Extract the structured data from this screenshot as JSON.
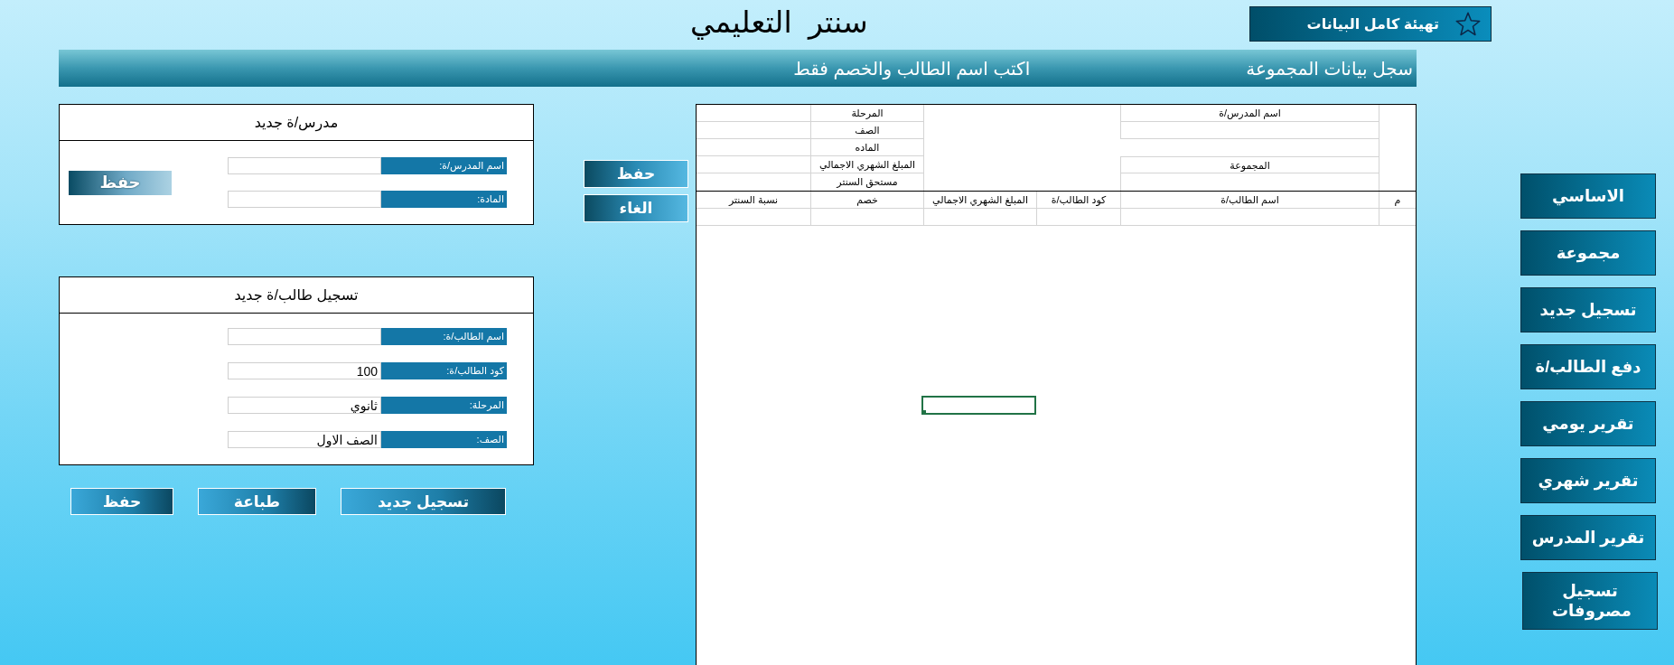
{
  "header": {
    "title": "سنتر  التعليمي",
    "reset_button": "تهيئة كامل البيانات"
  },
  "banner": {
    "title": "سجل بيانات المجموعة",
    "hint": "اكتب اسم الطالب والخصم فقط"
  },
  "teacher_form": {
    "title": "مدرس/ة جديد",
    "fields": [
      {
        "label": "اسم المدرس/ة:"
      },
      {
        "label": "المادة:"
      }
    ],
    "save_button": "حفظ"
  },
  "student_form": {
    "title": "تسجيل طالب/ة جديد",
    "fields": [
      {
        "label": "اسم الطالب/ة:"
      },
      {
        "label": "كود الطالب/ة:",
        "value": "100"
      },
      {
        "label": "المرحلة:",
        "value": "ثانوي"
      },
      {
        "label": "الصف:",
        "value": "الصف الاول"
      }
    ]
  },
  "form_buttons": [
    "تسجيل جديد",
    "طباعة",
    "حفظ"
  ],
  "sheet_buttons": [
    "حفظ",
    "الغاء"
  ],
  "sheet": {
    "teacher_label": "اسم المدرس/ة",
    "group_label": "المجموعة",
    "info_labels": [
      "المرحلة",
      "الصف",
      "الماده",
      "المبلغ الشهري الاجمالي",
      "مستحق السنتر"
    ],
    "columns": [
      "م",
      "اسم الطالب/ة",
      "كود الطالب/ة",
      "المبلغ الشهري الاجمالي",
      "خصم",
      "نسبة السنتر"
    ],
    "cell_cursor": true
  },
  "nav": [
    "الاساسي",
    "مجموعة",
    "تسجيل جديد",
    "دفع الطالب/ة",
    "تقرير يومي",
    "تقرير شهري",
    "تقرير المدرس",
    "تسجيل مصروفات"
  ]
}
